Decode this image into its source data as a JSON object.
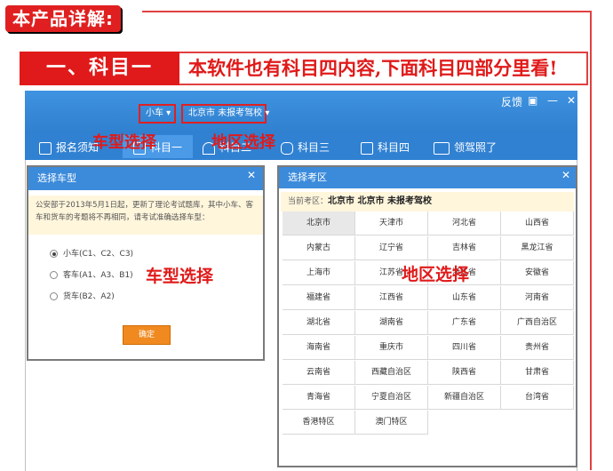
{
  "header": {
    "detail_tag": "本产品详解:",
    "section_label": "一、科目一",
    "section_text": "本软件也有科目四内容,下面科目四部分里看!"
  },
  "app": {
    "window_controls": [
      "反馈",
      "▣",
      "—",
      "✕"
    ],
    "car_selector": "小车 ▾",
    "region_selector": "北京市  未报考驾校 ▾",
    "nav": [
      {
        "label": "报名须知",
        "icon": "document-icon"
      },
      {
        "label": "科目一",
        "icon": "edit-icon"
      },
      {
        "label": "科目二",
        "icon": "cone-icon"
      },
      {
        "label": "科目三",
        "icon": "car-icon"
      },
      {
        "label": "科目四",
        "icon": "book-icon"
      },
      {
        "label": "领驾照了",
        "icon": "license-icon"
      }
    ]
  },
  "annotations": {
    "car_type_top": "车型选择",
    "region_top": "地区选择",
    "car_type_dialog": "车型选择",
    "region_dialog": "地区选择"
  },
  "car_dialog": {
    "title": "选择车型",
    "close": "✕",
    "notice": "公安部于2013年5月1日起，更新了理论考试题库，其中小车、客车和货车的考题将不再相同，请考试准确选择车型：",
    "options": [
      {
        "label": "小车(C1、C2、C3)",
        "checked": true
      },
      {
        "label": "客车(A1、A3、B1)",
        "checked": false
      },
      {
        "label": "货车(B2、A2)",
        "checked": false
      }
    ],
    "ok": "确定"
  },
  "region_dialog": {
    "title": "选择考区",
    "close": "✕",
    "current_label": "当前考区：",
    "current_value": "北京市  北京市  未报考驾校",
    "regions": [
      "北京市",
      "天津市",
      "河北省",
      "山西省",
      "内蒙古",
      "辽宁省",
      "吉林省",
      "黑龙江省",
      "上海市",
      "江苏省",
      "浙江省",
      "安徽省",
      "福建省",
      "江西省",
      "山东省",
      "河南省",
      "湖北省",
      "湖南省",
      "广东省",
      "广西自治区",
      "海南省",
      "重庆市",
      "四川省",
      "贵州省",
      "云南省",
      "西藏自治区",
      "陕西省",
      "甘肃省",
      "青海省",
      "宁夏自治区",
      "新疆自治区",
      "台湾省",
      "香港特区",
      "澳门特区"
    ],
    "selected": "北京市"
  },
  "colors": {
    "accent_red": "#e01a1a",
    "app_blue": "#3a8ad8",
    "ok_orange": "#f08a20",
    "notice_bg": "#fff6dc"
  }
}
